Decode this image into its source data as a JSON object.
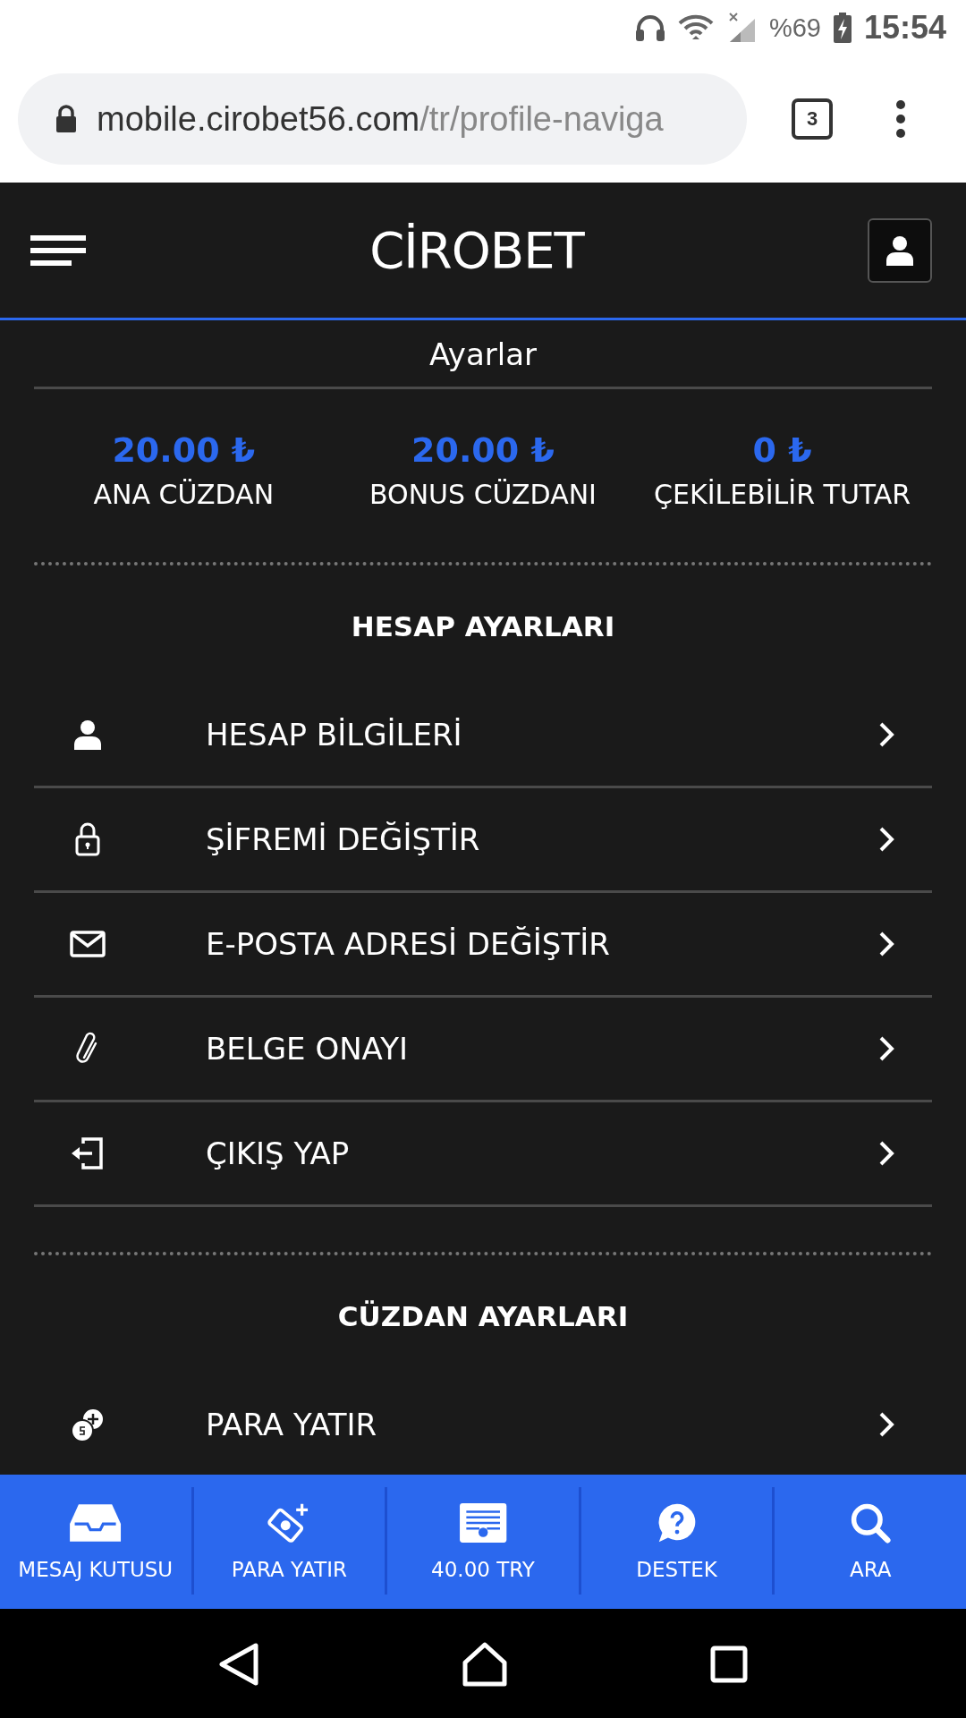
{
  "status_bar": {
    "battery": "%69",
    "time": "15:54"
  },
  "browser": {
    "url_host": "mobile.cirobet56.com",
    "url_path": "/tr/profile-naviga",
    "tab_count": "3"
  },
  "header": {
    "logo": "CİROBET"
  },
  "page_title": "Ayarlar",
  "wallets": [
    {
      "amount": "20.00 ₺",
      "label": "ANA CÜZDAN"
    },
    {
      "amount": "20.00 ₺",
      "label": "BONUS CÜZDANI"
    },
    {
      "amount": "0 ₺",
      "label": "ÇEKİLEBİLİR TUTAR"
    }
  ],
  "sections": [
    {
      "title": "HESAP AYARLARI",
      "items": [
        {
          "kind": "user",
          "label": "HESAP BİLGİLERİ"
        },
        {
          "kind": "lock",
          "label": "ŞİFREMİ DEĞİŞTİR"
        },
        {
          "kind": "mail",
          "label": "E-POSTA ADRESİ DEĞİŞTİR"
        },
        {
          "kind": "clip",
          "label": "BELGE ONAYI"
        },
        {
          "kind": "logout",
          "label": "ÇIKIŞ YAP"
        }
      ]
    },
    {
      "title": "CÜZDAN AYARLARI",
      "items": [
        {
          "kind": "coins",
          "label": "PARA YATIR"
        }
      ]
    }
  ],
  "bottom_nav": [
    {
      "kind": "inbox",
      "label": "MESAJ KUTUSU"
    },
    {
      "kind": "money",
      "label": "PARA YATIR"
    },
    {
      "kind": "balance",
      "label": "40.00 TRY"
    },
    {
      "kind": "help",
      "label": "DESTEK"
    },
    {
      "kind": "search",
      "label": "ARA"
    }
  ]
}
